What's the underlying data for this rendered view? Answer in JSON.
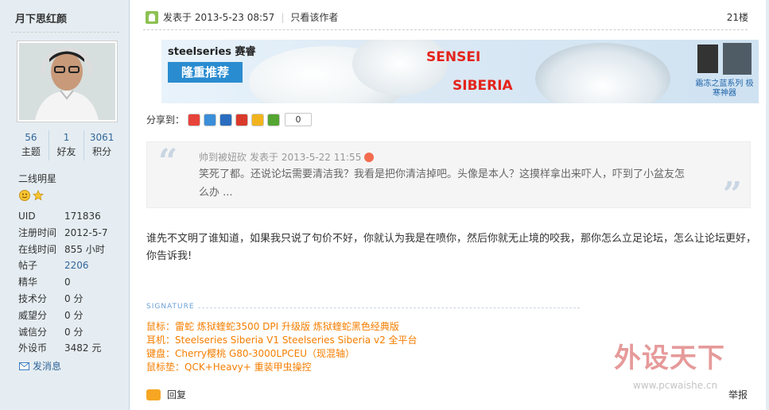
{
  "user": {
    "name": "月下思红颜",
    "stats": [
      {
        "value": "56",
        "label": "主题"
      },
      {
        "value": "1",
        "label": "好友"
      },
      {
        "value": "3061",
        "label": "积分"
      }
    ],
    "group": "二线明星",
    "info": [
      {
        "key": "UID",
        "value": "171836"
      },
      {
        "key": "注册时间",
        "value": "2012-5-7"
      },
      {
        "key": "在线时间",
        "value": "855 小时"
      },
      {
        "key": "帖子",
        "value": "2206"
      },
      {
        "key": "精华",
        "value": "0"
      },
      {
        "key": "技术分",
        "value": "0 分"
      },
      {
        "key": "威望分",
        "value": "0 分"
      },
      {
        "key": "诚信分",
        "value": "0 分"
      },
      {
        "key": "外设币",
        "value": "3482 元"
      }
    ],
    "send_message": "发消息"
  },
  "post": {
    "posted_at": "发表于 2013-5-23 08:57",
    "only_author": "只看该作者",
    "floor": "21楼",
    "share_label": "分享到：",
    "share_count": "0",
    "quote": {
      "author": "帅到被妞砍",
      "posted_at": "发表于 2013-5-22 11:55",
      "text": "笑死了都。还说论坛需要清洁我？我看是把你清洁掉吧。头像是本人？这摸样拿出来吓人，吓到了小盆友怎么办 ..."
    },
    "body": "谁先不文明了谁知道，如果我只说了句价不好，你就认为我是在喷你，然后你就无止境的咬我，那你怎么立足论坛，怎么让论坛更好，你告诉我!",
    "signature_label": "SIGNATURE",
    "signature": [
      "鼠标：雷蛇 炼狱蝰蛇3500 DPI 升级版  炼狱蝰蛇黑色经典版",
      "耳机：Steelseries Siberia V1 Steelseries Siberia v2 全平台",
      "键盘：Cherry樱桃 G80-3000LPCEU（现混轴）",
      "鼠标垫：QCK+Heavy+ 重装甲虫操控"
    ],
    "reply": "回复",
    "report": "举报"
  },
  "banner": {
    "brand": "steelseries 赛睿",
    "promo": "隆重推荐",
    "product1": "SENSEI",
    "product2": "SIBERIA",
    "caption": "霜冻之蓝系列 极寒神器"
  },
  "watermark": {
    "main": "外设天下",
    "url": "www.pcwaishe.cn"
  }
}
